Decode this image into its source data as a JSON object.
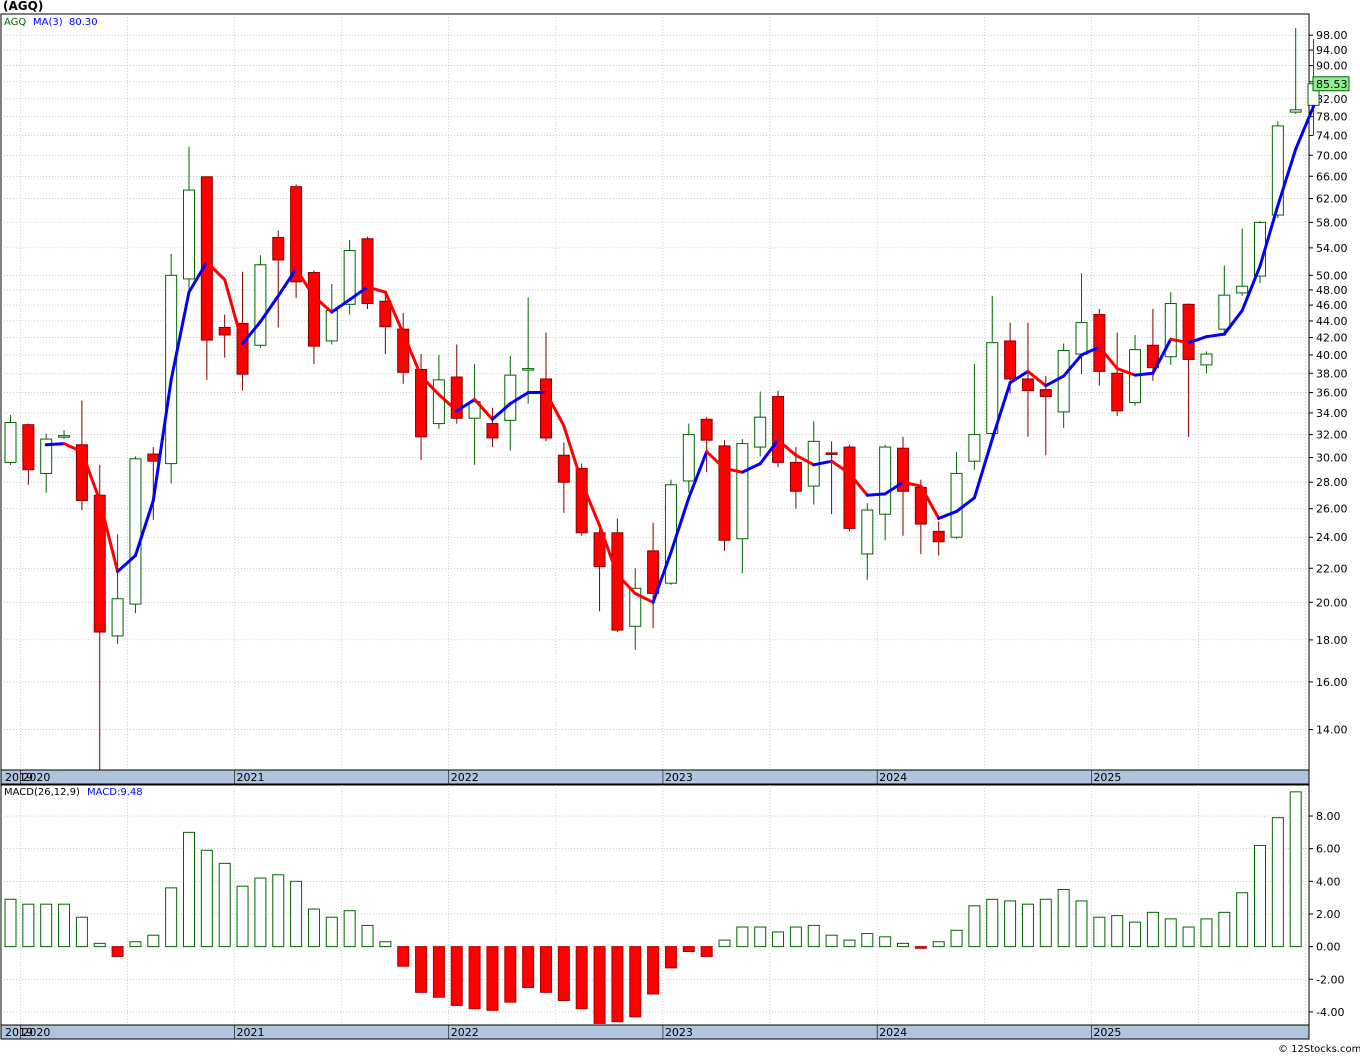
{
  "ticker_title": "(AGQ)",
  "watermark": "© 12Stocks.com",
  "colors": {
    "up_candle_fill": "#ffffff",
    "up_candle_stroke": "#006400",
    "down_candle": "#ff0000",
    "ma_rising": "#0000ff",
    "ma_falling": "#ff0000",
    "macd_positive_stroke": "#006400",
    "macd_negative": "#ff0000",
    "price_tag": "#90ee90",
    "date_strip": "#b0c4de",
    "grid": "#b0b0b0"
  },
  "chart_data": [
    {
      "type": "candlestick",
      "panel": "price",
      "legend": {
        "symbol": "AGQ",
        "ma_label": "MA(3)",
        "ma_value": "80.30"
      },
      "last_price_label": "85.53",
      "y_scale": "log",
      "ylim": [
        12.5,
        104
      ],
      "y_ticks": [
        "98.00",
        "94.00",
        "90.00",
        "86.00",
        "82.00",
        "78.00",
        "74.00",
        "70.00",
        "66.00",
        "62.00",
        "58.00",
        "54.00",
        "50.00",
        "48.00",
        "46.00",
        "44.00",
        "42.00",
        "40.00",
        "38.00",
        "36.00",
        "34.00",
        "32.00",
        "30.00",
        "28.00",
        "26.00",
        "24.00",
        "22.00",
        "20.00",
        "18.00",
        "16.00",
        "14.00"
      ],
      "x_labels": [
        "2019",
        "2020",
        "2021",
        "2022",
        "2023",
        "2024",
        "2025"
      ],
      "grid": true,
      "interval": "monthly",
      "candles": [
        {
          "date": "2019-12",
          "o": 29.6,
          "h": 33.8,
          "l": 29.4,
          "c": 33.1
        },
        {
          "date": "2020-01",
          "o": 32.9,
          "h": 33.0,
          "l": 27.8,
          "c": 29.0
        },
        {
          "date": "2020-02",
          "o": 28.7,
          "h": 32.1,
          "l": 27.2,
          "c": 31.6
        },
        {
          "date": "2020-03",
          "o": 31.8,
          "h": 32.4,
          "l": 31.6,
          "c": 31.9
        },
        {
          "date": "2020-04",
          "o": 31.1,
          "h": 35.2,
          "l": 25.9,
          "c": 26.6
        },
        {
          "date": "2020-05",
          "o": 27.0,
          "h": 29.4,
          "l": 12.4,
          "c": 18.4
        },
        {
          "date": "2020-06",
          "o": 18.2,
          "h": 24.2,
          "l": 17.8,
          "c": 20.2
        },
        {
          "date": "2020-07",
          "o": 19.9,
          "h": 30.1,
          "l": 19.4,
          "c": 29.9
        },
        {
          "date": "2020-08",
          "o": 30.3,
          "h": 30.9,
          "l": 25.2,
          "c": 29.7
        },
        {
          "date": "2020-09",
          "o": 29.5,
          "h": 53.1,
          "l": 27.9,
          "c": 50.0
        },
        {
          "date": "2020-10",
          "o": 49.5,
          "h": 71.7,
          "l": 48.0,
          "c": 63.5
        },
        {
          "date": "2020-11",
          "o": 65.9,
          "h": 66.0,
          "l": 37.3,
          "c": 41.7
        },
        {
          "date": "2020-12",
          "o": 43.2,
          "h": 44.8,
          "l": 39.7,
          "c": 42.3
        },
        {
          "date": "2021-01",
          "o": 43.7,
          "h": 50.5,
          "l": 36.2,
          "c": 37.9
        },
        {
          "date": "2021-02",
          "o": 41.1,
          "h": 52.9,
          "l": 40.8,
          "c": 51.5
        },
        {
          "date": "2021-03",
          "o": 55.6,
          "h": 56.7,
          "l": 43.2,
          "c": 52.2
        },
        {
          "date": "2021-04",
          "o": 64.1,
          "h": 64.5,
          "l": 46.9,
          "c": 49.1
        },
        {
          "date": "2021-05",
          "o": 50.4,
          "h": 50.7,
          "l": 39.0,
          "c": 41.0
        },
        {
          "date": "2021-06",
          "o": 41.6,
          "h": 48.8,
          "l": 41.2,
          "c": 45.3
        },
        {
          "date": "2021-07",
          "o": 46.1,
          "h": 55.2,
          "l": 44.8,
          "c": 53.6
        },
        {
          "date": "2021-08",
          "o": 55.4,
          "h": 55.7,
          "l": 45.5,
          "c": 46.2
        },
        {
          "date": "2021-09",
          "o": 46.5,
          "h": 47.5,
          "l": 40.1,
          "c": 43.3
        },
        {
          "date": "2021-10",
          "o": 43.0,
          "h": 45.0,
          "l": 36.9,
          "c": 38.1
        },
        {
          "date": "2021-11",
          "o": 38.4,
          "h": 40.1,
          "l": 29.8,
          "c": 31.8
        },
        {
          "date": "2021-12",
          "o": 33.0,
          "h": 40.0,
          "l": 32.5,
          "c": 37.3
        },
        {
          "date": "2022-01",
          "o": 37.6,
          "h": 41.2,
          "l": 33.0,
          "c": 33.5
        },
        {
          "date": "2022-02",
          "o": 33.5,
          "h": 39.0,
          "l": 29.4,
          "c": 35.1
        },
        {
          "date": "2022-03",
          "o": 33.0,
          "h": 34.5,
          "l": 30.9,
          "c": 31.7
        },
        {
          "date": "2022-04",
          "o": 33.3,
          "h": 39.9,
          "l": 30.6,
          "c": 37.8
        },
        {
          "date": "2022-05",
          "o": 38.5,
          "h": 47.0,
          "l": 34.9,
          "c": 38.5
        },
        {
          "date": "2022-06",
          "o": 37.4,
          "h": 42.6,
          "l": 31.4,
          "c": 31.7
        },
        {
          "date": "2022-07",
          "o": 30.2,
          "h": 31.3,
          "l": 25.7,
          "c": 28.0
        },
        {
          "date": "2022-08",
          "o": 29.1,
          "h": 29.5,
          "l": 24.1,
          "c": 24.3
        },
        {
          "date": "2022-09",
          "o": 24.3,
          "h": 25.0,
          "l": 19.5,
          "c": 22.1
        },
        {
          "date": "2022-10",
          "o": 24.3,
          "h": 25.3,
          "l": 18.4,
          "c": 18.5
        },
        {
          "date": "2022-11",
          "o": 18.7,
          "h": 22.0,
          "l": 17.5,
          "c": 20.8
        },
        {
          "date": "2022-12",
          "o": 23.1,
          "h": 25.0,
          "l": 18.6,
          "c": 20.5
        },
        {
          "date": "2023-01",
          "o": 21.1,
          "h": 28.2,
          "l": 21.0,
          "c": 27.8
        },
        {
          "date": "2023-02",
          "o": 28.1,
          "h": 33.0,
          "l": 27.2,
          "c": 32.0
        },
        {
          "date": "2023-03",
          "o": 33.4,
          "h": 33.6,
          "l": 28.8,
          "c": 31.5
        },
        {
          "date": "2023-04",
          "o": 31.0,
          "h": 31.5,
          "l": 23.1,
          "c": 23.8
        },
        {
          "date": "2023-05",
          "o": 23.9,
          "h": 31.6,
          "l": 21.7,
          "c": 31.2
        },
        {
          "date": "2023-06",
          "o": 30.9,
          "h": 36.1,
          "l": 30.1,
          "c": 33.6
        },
        {
          "date": "2023-07",
          "o": 35.6,
          "h": 36.2,
          "l": 29.2,
          "c": 29.6
        },
        {
          "date": "2023-08",
          "o": 29.6,
          "h": 30.9,
          "l": 26.0,
          "c": 27.3
        },
        {
          "date": "2023-09",
          "o": 27.7,
          "h": 33.2,
          "l": 26.3,
          "c": 31.4
        },
        {
          "date": "2023-10",
          "o": 30.4,
          "h": 31.4,
          "l": 25.6,
          "c": 30.3
        },
        {
          "date": "2023-11",
          "o": 30.9,
          "h": 31.1,
          "l": 24.4,
          "c": 24.6
        },
        {
          "date": "2023-12",
          "o": 22.9,
          "h": 26.4,
          "l": 21.3,
          "c": 25.9
        },
        {
          "date": "2024-01",
          "o": 25.6,
          "h": 31.1,
          "l": 23.8,
          "c": 30.9
        },
        {
          "date": "2024-02",
          "o": 30.8,
          "h": 31.8,
          "l": 24.1,
          "c": 27.3
        },
        {
          "date": "2024-03",
          "o": 27.6,
          "h": 28.2,
          "l": 22.9,
          "c": 24.9
        },
        {
          "date": "2024-04",
          "o": 24.4,
          "h": 25.1,
          "l": 22.8,
          "c": 23.7
        },
        {
          "date": "2024-05",
          "o": 24.0,
          "h": 30.5,
          "l": 23.9,
          "c": 28.7
        },
        {
          "date": "2024-06",
          "o": 29.7,
          "h": 39.0,
          "l": 29.0,
          "c": 32.0
        },
        {
          "date": "2024-07",
          "o": 32.1,
          "h": 47.2,
          "l": 31.4,
          "c": 41.4
        },
        {
          "date": "2024-08",
          "o": 41.6,
          "h": 43.8,
          "l": 35.9,
          "c": 37.4
        },
        {
          "date": "2024-09",
          "o": 37.4,
          "h": 43.8,
          "l": 31.8,
          "c": 36.2
        },
        {
          "date": "2024-10",
          "o": 36.3,
          "h": 37.7,
          "l": 30.2,
          "c": 35.6
        },
        {
          "date": "2024-11",
          "o": 34.1,
          "h": 41.3,
          "l": 32.6,
          "c": 40.5
        },
        {
          "date": "2024-12",
          "o": 40.1,
          "h": 50.3,
          "l": 37.9,
          "c": 43.8
        },
        {
          "date": "2025-01",
          "o": 44.8,
          "h": 45.5,
          "l": 36.7,
          "c": 38.2
        },
        {
          "date": "2025-02",
          "o": 38.0,
          "h": 42.6,
          "l": 33.7,
          "c": 34.2
        },
        {
          "date": "2025-03",
          "o": 35.0,
          "h": 42.3,
          "l": 34.7,
          "c": 40.6
        },
        {
          "date": "2025-04",
          "o": 41.1,
          "h": 45.5,
          "l": 37.2,
          "c": 38.6
        },
        {
          "date": "2025-05",
          "o": 39.8,
          "h": 47.7,
          "l": 38.9,
          "c": 46.2
        },
        {
          "date": "2025-06",
          "o": 46.1,
          "h": 46.2,
          "l": 31.8,
          "c": 39.5
        },
        {
          "date": "2025-07",
          "o": 38.9,
          "h": 40.4,
          "l": 38.0,
          "c": 40.1
        },
        {
          "date": "2025-08",
          "o": 43.0,
          "h": 51.4,
          "l": 42.5,
          "c": 47.3
        },
        {
          "date": "2025-09",
          "o": 47.6,
          "h": 57.0,
          "l": 47.2,
          "c": 48.5
        },
        {
          "date": "2025-10",
          "o": 49.9,
          "h": 58.2,
          "l": 48.9,
          "c": 58.0
        },
        {
          "date": "2025-11",
          "o": 59.2,
          "h": 77.0,
          "l": 58.7,
          "c": 76.0
        },
        {
          "date": "2025-12",
          "o": 79.0,
          "h": 100.0,
          "l": 78.6,
          "c": 79.5
        },
        {
          "date": "2026-01",
          "o": 80.5,
          "h": 97.0,
          "l": 74.0,
          "c": 85.53
        }
      ],
      "ma3": [
        null,
        null,
        31.1,
        31.2,
        30.5,
        26.6,
        21.8,
        22.8,
        26.6,
        37.3,
        47.7,
        51.9,
        49.4,
        41.3,
        43.9,
        47.2,
        50.9,
        47.1,
        45.1,
        46.7,
        48.4,
        47.7,
        42.5,
        37.7,
        35.8,
        34.2,
        35.3,
        33.4,
        34.9,
        36.0,
        36.0,
        32.8,
        28.0,
        24.8,
        21.6,
        20.5,
        20.0,
        23.0,
        26.8,
        30.5,
        29.1,
        28.8,
        29.5,
        31.5,
        30.2,
        29.4,
        29.7,
        28.7,
        27.0,
        27.1,
        28.0,
        27.7,
        25.3,
        25.8,
        26.8,
        31.6,
        37.0,
        38.2,
        36.7,
        37.7,
        40.0,
        40.9,
        38.5,
        37.8,
        38.0,
        41.8,
        41.4,
        42.1,
        42.4,
        45.3,
        51.3,
        60.8,
        71.2,
        80.3
      ]
    },
    {
      "type": "bar",
      "panel": "macd",
      "legend": {
        "label": "MACD(26,12,9)",
        "value_label": "MACD:9.48"
      },
      "ylim": [
        -4.8,
        9.9
      ],
      "y_ticks": [
        "8.00",
        "6.00",
        "4.00",
        "2.00",
        "0.00",
        "-2.00",
        "-4.00"
      ],
      "x_labels": [
        "2019",
        "2020",
        "2021",
        "2022",
        "2023",
        "2024",
        "2025"
      ],
      "values": [
        2.9,
        2.6,
        2.6,
        2.6,
        1.8,
        0.2,
        -0.6,
        0.3,
        0.7,
        3.6,
        7.0,
        5.9,
        5.1,
        3.7,
        4.2,
        4.4,
        4.0,
        2.3,
        1.8,
        2.2,
        1.3,
        0.3,
        -1.2,
        -2.8,
        -3.1,
        -3.6,
        -3.8,
        -3.9,
        -3.4,
        -2.5,
        -2.8,
        -3.3,
        -3.8,
        -4.7,
        -4.6,
        -4.3,
        -2.9,
        -1.3,
        -0.3,
        -0.6,
        0.4,
        1.2,
        1.2,
        0.9,
        1.2,
        1.3,
        0.7,
        0.4,
        0.8,
        0.6,
        0.2,
        -0.1,
        0.3,
        1.0,
        2.5,
        2.9,
        2.8,
        2.6,
        2.9,
        3.5,
        2.8,
        1.8,
        1.9,
        1.5,
        2.1,
        1.7,
        1.2,
        1.7,
        2.1,
        3.3,
        6.2,
        7.9,
        9.48
      ]
    }
  ]
}
